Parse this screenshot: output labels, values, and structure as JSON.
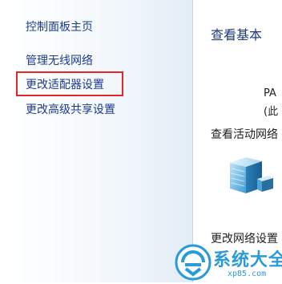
{
  "sidebar": {
    "home_link": "控制面板主页",
    "items": [
      {
        "label": "管理无线网络"
      },
      {
        "label": "更改适配器设置"
      },
      {
        "label": "更改高级共享设置"
      }
    ],
    "highlight_color": "#e3262c"
  },
  "main": {
    "title": "查看基本",
    "network_name": "PA",
    "network_sub": "(此",
    "active_label": "查看活动网络",
    "change_label": "更改网络设置"
  },
  "watermark": {
    "text": "系统大全",
    "url": "xp85.com",
    "color": "#2b9ad8"
  },
  "icons": {
    "network": "network-building-icon",
    "logo": "watermark-logo-icon"
  }
}
